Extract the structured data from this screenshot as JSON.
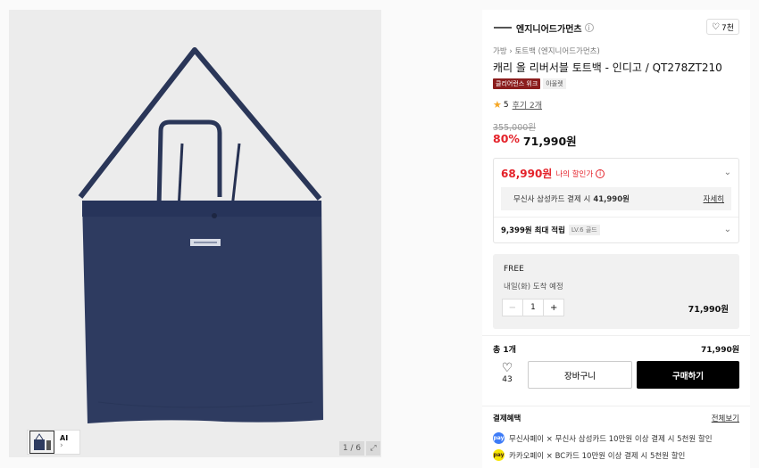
{
  "gallery": {
    "thumb_ai_label": "AI",
    "thumb_chevron": "›",
    "counter": "1 / 6",
    "expand_icon": "expand-icon"
  },
  "brand": {
    "name": "엔지니어드가먼츠",
    "info_icon": "i",
    "likes": "7천"
  },
  "breadcrumb": "가방 › 토트백 (엔지니어드가먼츠)",
  "title": "캐리 올 리버서블 토트백 - 인디고 / QT278ZT210",
  "badges": {
    "clearance": "클리어런스 위크",
    "outlet": "아울렛"
  },
  "rating": {
    "score": "5",
    "reviews": "후기 2개"
  },
  "price": {
    "original": "355,000원",
    "discount": "80%",
    "current": "71,990원"
  },
  "coupon": {
    "my_price": "68,990원",
    "my_price_label": "나의 할인가",
    "card_text": "무신사 삼성카드 결제 시",
    "card_price": "41,990원",
    "detail": "자세히",
    "points": "9,399원 최대 적립",
    "level": "LV.6 골드"
  },
  "option": {
    "shipping": "FREE",
    "arrival": "내일(화) 도착 예정",
    "qty": "1",
    "minus": "−",
    "plus": "+",
    "price": "71,990원"
  },
  "total": {
    "label": "총 1개",
    "price": "71,990원"
  },
  "actions": {
    "wish_count": "43",
    "cart": "장바구니",
    "buy": "구매하기"
  },
  "benefits": {
    "heading": "결제혜택",
    "view_all": "전체보기",
    "items": [
      {
        "icon_text": "pay",
        "text": "무신사페이 × 무신사 삼성카드 10만원 이상 결제 시 5천원 할인"
      },
      {
        "icon_text": "pay",
        "text": "카카오페이 × BC카드 10만원 이상 결제 시 5천원 할인"
      }
    ]
  },
  "colors": {
    "accent_red": "#e4222a",
    "badge_red": "#8b1d1d",
    "bag_navy": "#2c3a5e",
    "buy_black": "#000000"
  }
}
